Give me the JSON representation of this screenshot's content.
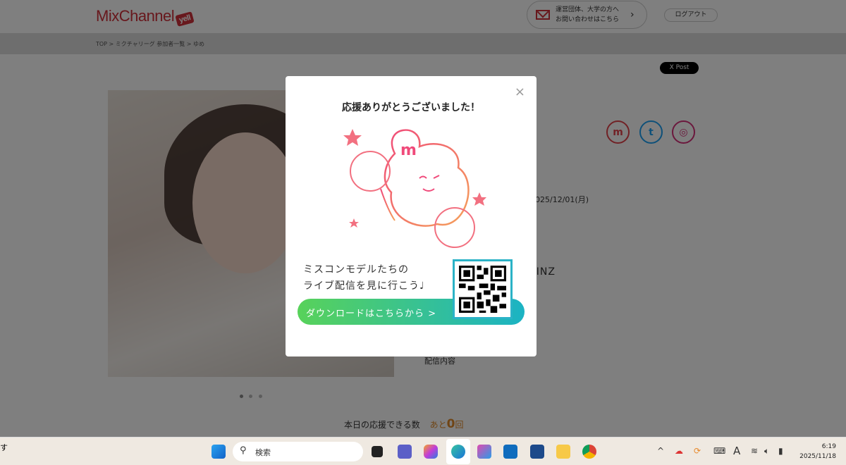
{
  "header": {
    "logo": "MixChannel",
    "logo_badge": "yell",
    "contact_line1": "運営団体、大学の方へ",
    "contact_line2": "お問い合わせはこちら",
    "logout": "ログアウト"
  },
  "breadcrumb": "TOP > ミクチャリーグ 参加者一覧 > ゆめ",
  "share": {
    "x_post": "X Post"
  },
  "profile": {
    "date": "2025/12/01(月)",
    "name_partial": "RINZ",
    "stream_label": "配信内容",
    "support_label": "本日の応援できる数",
    "support_prefix": "あと",
    "support_count": "0",
    "support_suffix": "回"
  },
  "social": [
    {
      "icon": "mixchannel-icon",
      "glyph": "m",
      "color": "#e2434b"
    },
    {
      "icon": "twitter-icon",
      "glyph": "t",
      "color": "#1da1f2"
    },
    {
      "icon": "instagram-icon",
      "glyph": "◎",
      "color": "#d6307a"
    }
  ],
  "modal": {
    "title": "応援ありがとうございました！",
    "line1": "ミスコンモデルたちの",
    "line2": "ライブ配信を見に行こう♩",
    "download": "ダウンロードはこちらから >",
    "close": "×"
  },
  "taskbar": {
    "left_partial": "す",
    "search_placeholder": "検索",
    "time": "6:19",
    "date": "2025/11/18",
    "ime": "A"
  }
}
